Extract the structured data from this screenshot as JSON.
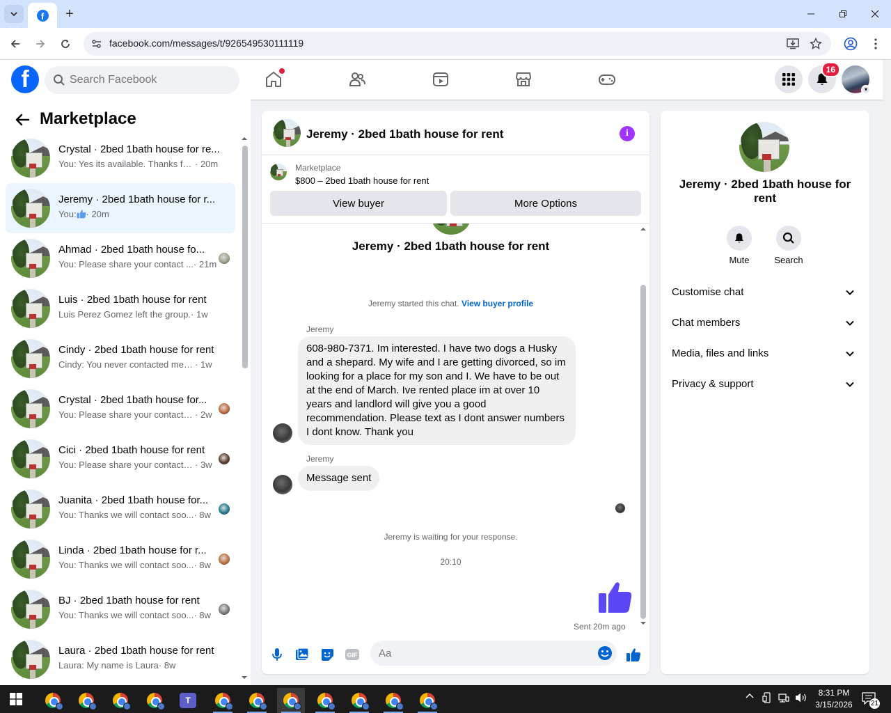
{
  "browser": {
    "url": "facebook.com/messages/t/926549530111119",
    "new_tab": "+",
    "colors": {
      "tabbar": "#d3e3fd",
      "omnibox": "#eef1f8"
    }
  },
  "fb_header": {
    "search_placeholder": "Search Facebook",
    "notifications_count": "16",
    "nav_icons": [
      "home-icon",
      "friends-icon",
      "video-icon",
      "marketplace-icon",
      "gaming-icon"
    ],
    "colors": {
      "brand": "#0866ff",
      "badge": "#e41e3f"
    }
  },
  "sidebar": {
    "title": "Marketplace",
    "conversations": [
      {
        "name": "Crystal · 2bed 1bath house for re...",
        "snippet": "You: Yes its available. Thanks for r...",
        "time": "· 20m",
        "active": false
      },
      {
        "name": "Jeremy · 2bed 1bath house for r...",
        "snippet": "You: ",
        "time": "· 20m",
        "active": true,
        "like": true
      },
      {
        "name": "Ahmad · 2bed 1bath house fo...",
        "snippet": "You: Please share your contact ...",
        "time": "· 21m",
        "active": false
      },
      {
        "name": "Luis · 2bed 1bath house for rent",
        "snippet": "Luis Perez Gomez left the group.",
        "time": "· 1w",
        "active": false
      },
      {
        "name": "Cindy · 2bed 1bath house for rent",
        "snippet": "Cindy: You never contacted me..is t...",
        "time": "· 1w",
        "active": false
      },
      {
        "name": "Crystal · 2bed 1bath house for...",
        "snippet": "You: Please share your contact n...",
        "time": "· 2w",
        "active": false
      },
      {
        "name": "Cici · 2bed 1bath house for rent",
        "snippet": "You: Please share your contact n...",
        "time": "· 3w",
        "active": false
      },
      {
        "name": "Juanita · 2bed 1bath house for...",
        "snippet": "You: Thanks we will contact soo...",
        "time": "· 8w",
        "active": false
      },
      {
        "name": "Linda · 2bed 1bath house for r...",
        "snippet": "You: Thanks we will contact soo...",
        "time": "· 8w",
        "active": false
      },
      {
        "name": "BJ · 2bed 1bath house for rent",
        "snippet": "You: Thanks we will contact soo...",
        "time": "· 8w",
        "active": false
      },
      {
        "name": "Laura · 2bed 1bath house for rent",
        "snippet": "Laura: My name is Laura",
        "time": "· 8w",
        "active": false
      }
    ]
  },
  "chat": {
    "title": "Jeremy · 2bed 1bath house for rent",
    "listing": {
      "source": "Marketplace",
      "price_title": "$800 – 2bed 1bath house for rent",
      "view_buyer": "View buyer",
      "more_options": "More Options"
    },
    "thread_title": "Jeremy · 2bed 1bath house for rent",
    "started_text": "Jeremy started this chat.",
    "view_profile": "View buyer profile",
    "messages": [
      {
        "sender": "Jeremy",
        "text": "608-980-7371. Im interested. I have two dogs a Husky and a shepard. My wife and I are getting divorced, so im looking for a place for my son and I. We have to be out at the end of March. Ive rented place im at over 10 years and landlord will give you a good recommendation. Please text as I dont answer numbers I dont know. Thank you"
      },
      {
        "sender": "Jeremy",
        "text": "Message sent"
      }
    ],
    "waiting_text": "Jeremy is waiting for your response.",
    "timestamp": "20:10",
    "sent_status": "Sent 20m ago",
    "composer_placeholder": "Aa",
    "colors": {
      "accent": "#5b47f5",
      "link": "#0064d1",
      "info": "#a033ff"
    }
  },
  "right_panel": {
    "title": "Jeremy · 2bed 1bath house for rent",
    "mute": "Mute",
    "search": "Search",
    "sections": [
      "Customise chat",
      "Chat members",
      "Media, files and links",
      "Privacy & support"
    ]
  },
  "taskbar": {
    "time": "8:31 PM",
    "date": "3/15/2026",
    "notifications": "21",
    "apps": [
      "chrome",
      "chrome",
      "chrome",
      "chrome",
      "teams",
      "chrome",
      "chrome",
      "chrome",
      "chrome",
      "chrome",
      "chrome",
      "chrome"
    ]
  }
}
